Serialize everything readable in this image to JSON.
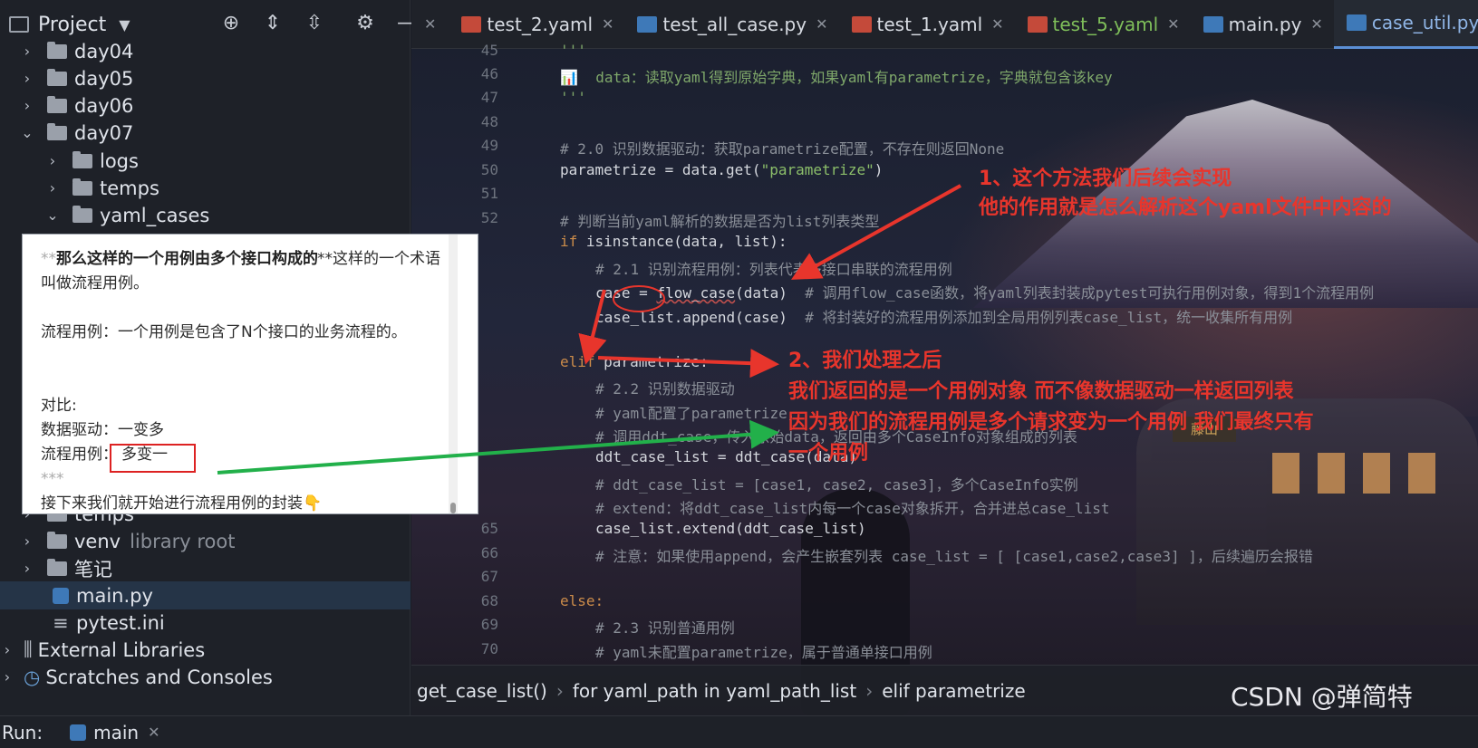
{
  "project_panel": {
    "title": "Project",
    "tree": [
      {
        "label": "day04",
        "expanded": false
      },
      {
        "label": "day05",
        "expanded": false
      },
      {
        "label": "day06",
        "expanded": false
      },
      {
        "label": "day07",
        "expanded": true
      },
      {
        "label": "logs",
        "expanded": false
      },
      {
        "label": "temps",
        "expanded": false
      },
      {
        "label": "yaml_cases",
        "expanded": true
      },
      {
        "label": "temps",
        "expanded": false
      },
      {
        "label": "venv",
        "note": "library root",
        "expanded": false
      },
      {
        "label": "笔记",
        "expanded": false
      },
      {
        "label": "main.py"
      },
      {
        "label": "pytest.ini"
      },
      {
        "label": "External Libraries",
        "expanded": false
      },
      {
        "label": "Scratches and Consoles",
        "expanded": false
      }
    ]
  },
  "tabs": [
    {
      "label": "test_2.yaml",
      "icon": "yaml-icon"
    },
    {
      "label": "test_all_case.py",
      "icon": "python-icon"
    },
    {
      "label": "test_1.yaml",
      "icon": "yaml-icon"
    },
    {
      "label": "test_5.yaml",
      "icon": "yaml-icon"
    },
    {
      "label": "main.py",
      "icon": "python-icon"
    },
    {
      "label": "case_util.py",
      "icon": "python-icon"
    }
  ],
  "code": {
    "line_numbers": [
      "45",
      "46",
      "47",
      "48",
      "49",
      "50",
      "51",
      "52",
      "65",
      "66",
      "67",
      "68",
      "69",
      "70"
    ],
    "l45": "'''",
    "l46": "📊  data：读取yaml得到原始字典，如果yaml有parametrize，字典就包含该key",
    "l47": "'''",
    "l49": "# 2.0 识别数据驱动：获取parametrize配置，不存在则返回None",
    "l50a": "parametrize = data.get(",
    "l50b": "\"parametrize\"",
    "l50c": ")",
    "l52": "# 判断当前yaml解析的数据是否为list列表类型",
    "l53a": "if",
    "l53b": " isinstance(data, list):",
    "l54": "# 2.1 识别流程用例：列表代表多接口串联的流程用例",
    "l55a": "case",
    "l55b": " = ",
    "l55c": "flow_case",
    "l55d": "(data)  ",
    "l55e": "# 调用flow_case函数，将yaml列表封装成pytest可执行用例对象，得到1个流程用例",
    "l56a": "case_list.append(case)  ",
    "l56b": "# 将封装好的流程用例添加到全局用例列表case_list，统一收集所有用例",
    "l58a": "elif",
    "l58b": " parametrize:",
    "l59": "# 2.2 识别数据驱动",
    "l60": "# yaml配置了parametrize，",
    "l61": "# 调用ddt_case，传入原始data，返回由多个CaseInfo对象组成的列表",
    "l62": "ddt_case_list = ddt_case(data)",
    "l63": "# ddt_case_list = [case1, case2, case3]，多个CaseInfo实例",
    "l64": "# extend：将ddt_case_list内每一个case对象拆开，合并进总case_list",
    "l65": "case_list.extend(ddt_case_list)",
    "l66": "# 注意：如果使用append，会产生嵌套列表 case_list = [ [case1,case2,case3] ]，后续遍历会报错",
    "l68": "else:",
    "l69": "# 2.3 识别普通用例",
    "l70": "# yaml未配置parametrize，属于普通单接口用例"
  },
  "breadcrumb": [
    "get_case_list()",
    "for yaml_path in yaml_path_list",
    "elif parametrize"
  ],
  "run_bar": {
    "label": "Run:",
    "config": "main"
  },
  "note_popup": {
    "l1_pre": "**",
    "l1_bold": "那么这样的一个用例由多个接口构成的",
    "l1_post": "**这样的一个术语",
    "l2": "叫做流程用例。",
    "l3": "流程用例：一个用例是包含了N个接口的业务流程的。",
    "l4": "对比:",
    "l5": "数据驱动：一变多",
    "l6_label": "流程用例：",
    "l6_value": "多变一",
    "l7": "***",
    "l8": "接下来我们就开始进行流程用例的封装👇"
  },
  "annotations": {
    "a1_line1": "1、这个方法我们后续会实现",
    "a1_line2": "他的作用就是怎么解析这个yaml文件中内容的",
    "a2_line1": "2、我们处理之后",
    "a2_line2": "我们返回的是一个用例对象 而不像数据驱动一样返回列表",
    "a2_line3": "因为我们的流程用例是多个请求变为一个用例 我们最终只有",
    "a2_line4": "一个用例"
  },
  "wallpaper_sign": "藤山",
  "watermark": "CSDN @弹简特",
  "colors": {
    "annotation_red": "#e8352c",
    "arrow_green": "#22b04a",
    "keyword": "#cc8c4a",
    "string": "#8cbf6a"
  }
}
